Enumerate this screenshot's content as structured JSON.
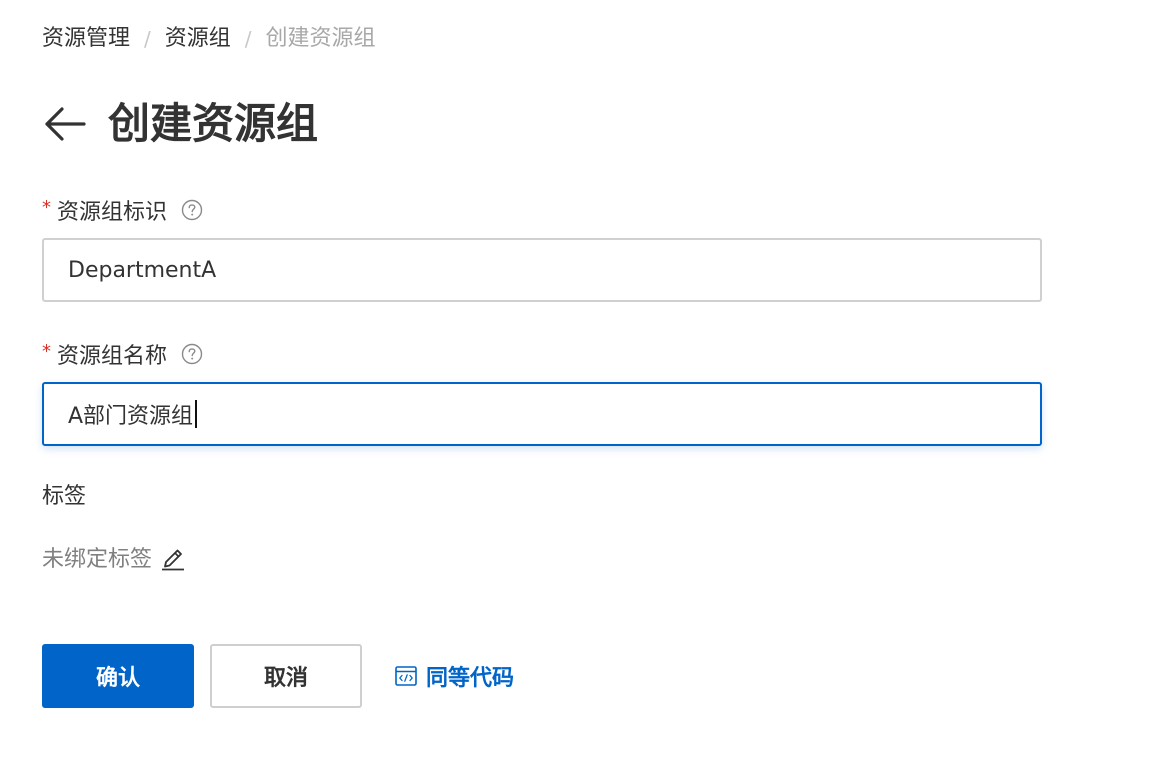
{
  "breadcrumb": {
    "items": [
      "资源管理",
      "资源组",
      "创建资源组"
    ],
    "separator": "/"
  },
  "header": {
    "back_icon": "arrow-left-icon",
    "title": "创建资源组"
  },
  "form": {
    "identifier": {
      "required_mark": "*",
      "label": "资源组标识",
      "help_icon": "question-circle-icon",
      "value": "DepartmentA"
    },
    "name": {
      "required_mark": "*",
      "label": "资源组名称",
      "help_icon": "question-circle-icon",
      "value": "A部门资源组",
      "focused": true
    },
    "tags": {
      "label": "标签",
      "value": "未绑定标签",
      "edit_icon": "pencil-icon"
    }
  },
  "actions": {
    "confirm_label": "确认",
    "cancel_label": "取消",
    "code_label": "同等代码",
    "code_icon": "code-window-icon"
  },
  "colors": {
    "primary": "#0064c8",
    "required": "#d93026",
    "text": "#333333",
    "muted": "#808080",
    "border": "#d0d0d0"
  }
}
